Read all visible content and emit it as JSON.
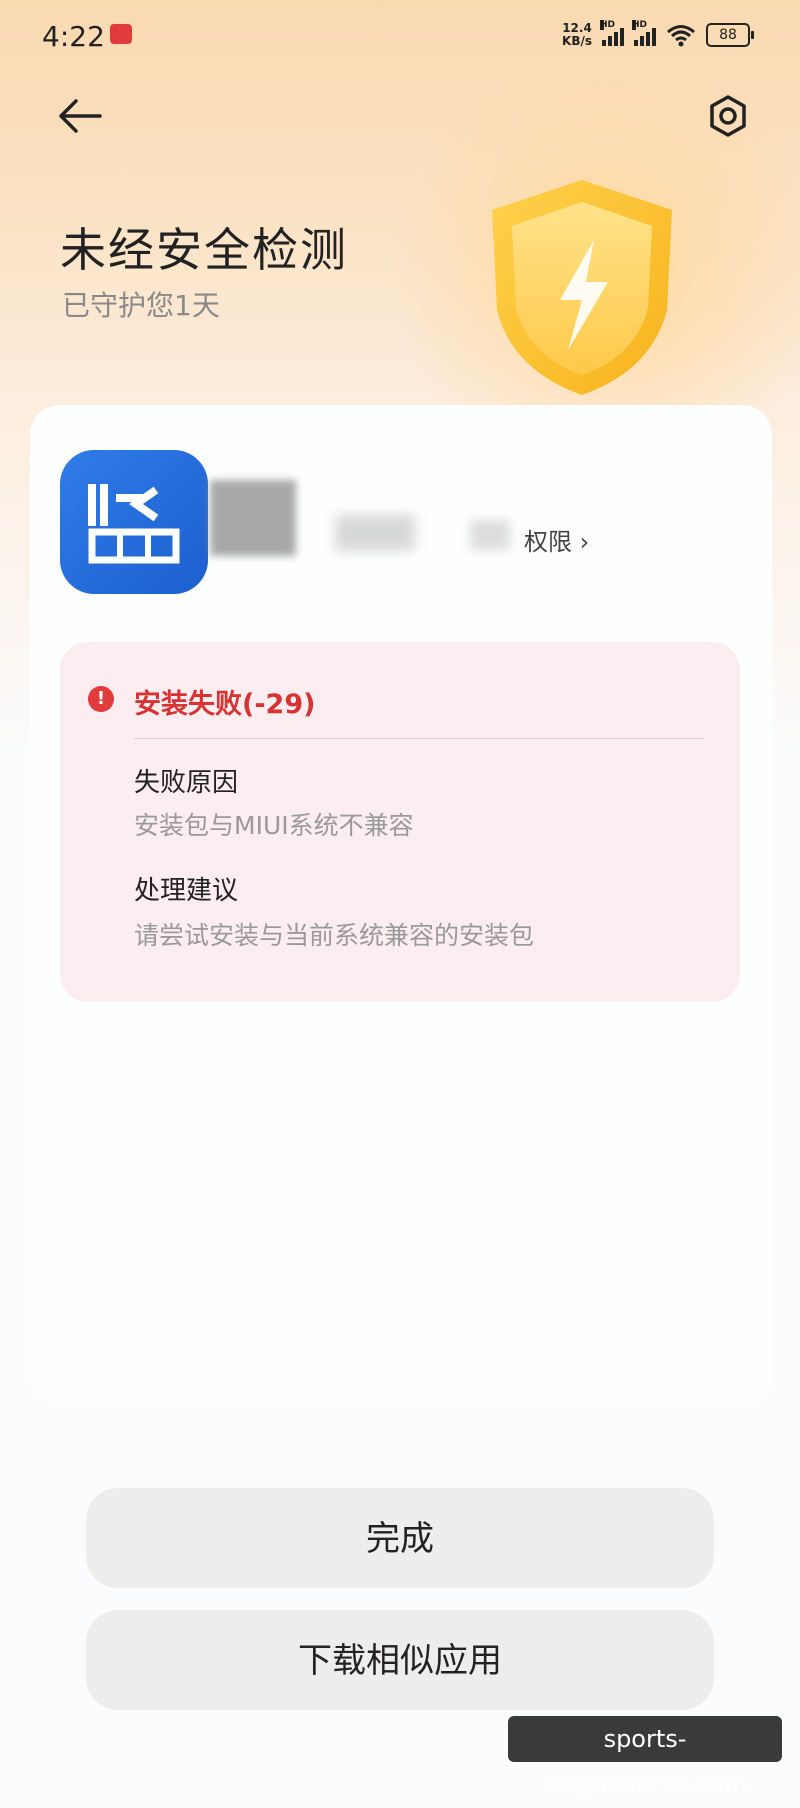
{
  "status_bar": {
    "time": "4:22",
    "net_speed_value": "12.4",
    "net_speed_unit": "KB/s",
    "signal_label": "HD",
    "battery": "88"
  },
  "header": {
    "title": "未经安全检测",
    "subtitle": "已守护您1天"
  },
  "app": {
    "permission_link": "权限 ›",
    "icon_color": "#2f7ce8"
  },
  "error": {
    "title": "安装失败(-29)",
    "reason_label": "失败原因",
    "reason_text": "安装包与MIUI系统不兼容",
    "suggestion_label": "处理建议",
    "suggestion_text": "请尝试安装与当前系统兼容的安装包",
    "color": "#d83232"
  },
  "buttons": {
    "done": "完成",
    "download_similar": "下载相似应用"
  },
  "watermark": "sports-kaiyunverse.com"
}
